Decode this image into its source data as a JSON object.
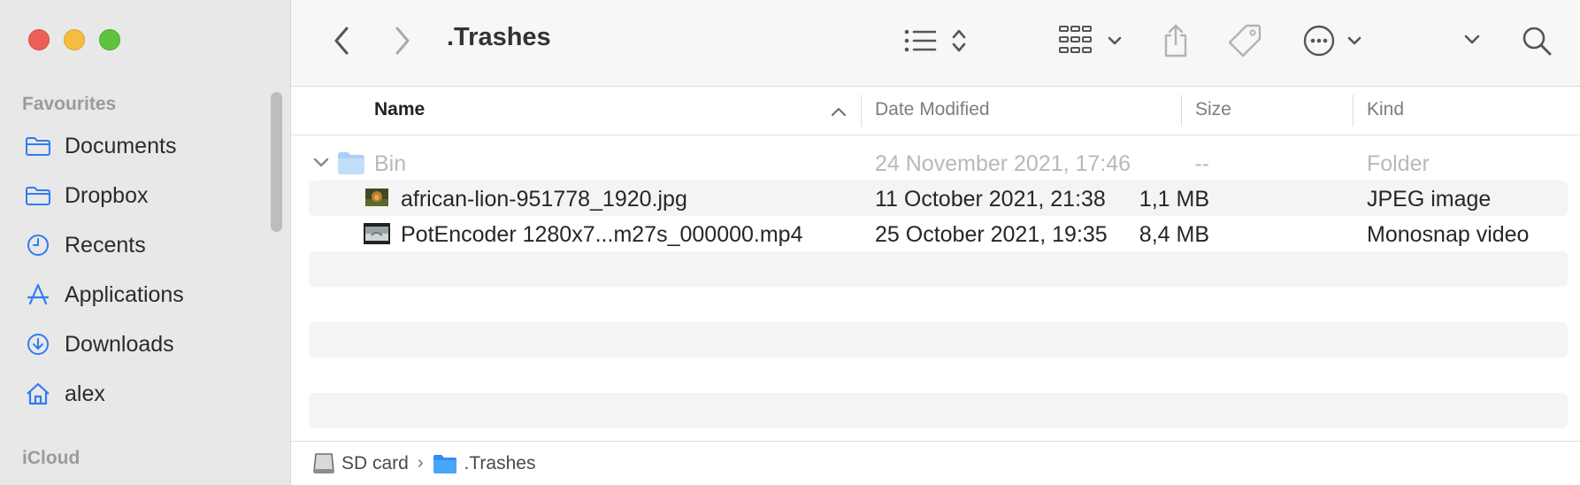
{
  "window": {
    "title": ".Trashes"
  },
  "sidebar": {
    "sections": [
      {
        "label": "Favourites"
      },
      {
        "label": "iCloud"
      }
    ],
    "items": [
      {
        "label": "Documents",
        "icon": "folder-icon"
      },
      {
        "label": "Dropbox",
        "icon": "folder-icon"
      },
      {
        "label": "Recents",
        "icon": "clock-icon"
      },
      {
        "label": "Applications",
        "icon": "applications-icon"
      },
      {
        "label": "Downloads",
        "icon": "download-icon"
      },
      {
        "label": "alex",
        "icon": "home-icon"
      }
    ]
  },
  "toolbar": {
    "back_icon": "chevron-left-icon",
    "forward_icon": "chevron-right-icon",
    "view_icon": "list-view-icon",
    "group_icon": "grid-group-icon",
    "share_icon": "share-icon",
    "tag_icon": "tag-icon",
    "more_icon": "ellipsis-circle-icon",
    "search_icon": "search-icon"
  },
  "columns": {
    "name": "Name",
    "date_modified": "Date Modified",
    "size": "Size",
    "kind": "Kind"
  },
  "files": [
    {
      "name": "Bin",
      "date": "24 November 2021, 17:46",
      "size": "--",
      "kind": "Folder",
      "type": "folder",
      "expanded": true
    },
    {
      "name": "african-lion-951778_1920.jpg",
      "date": "11 October 2021, 21:38",
      "size": "1,1 MB",
      "kind": "JPEG image",
      "type": "image"
    },
    {
      "name": "PotEncoder 1280x7...m27s_000000.mp4",
      "date": "25 October 2021, 19:35",
      "size": "8,4 MB",
      "kind": "Monosnap video",
      "type": "video"
    }
  ],
  "pathbar": [
    {
      "label": "SD card",
      "icon": "drive-icon"
    },
    {
      "label": ".Trashes",
      "icon": "folder-icon"
    }
  ],
  "colors": {
    "accent": "#2f7bf5",
    "close": "#ec5f57",
    "minimize": "#f4bd3f",
    "zoom": "#5ec43f"
  }
}
